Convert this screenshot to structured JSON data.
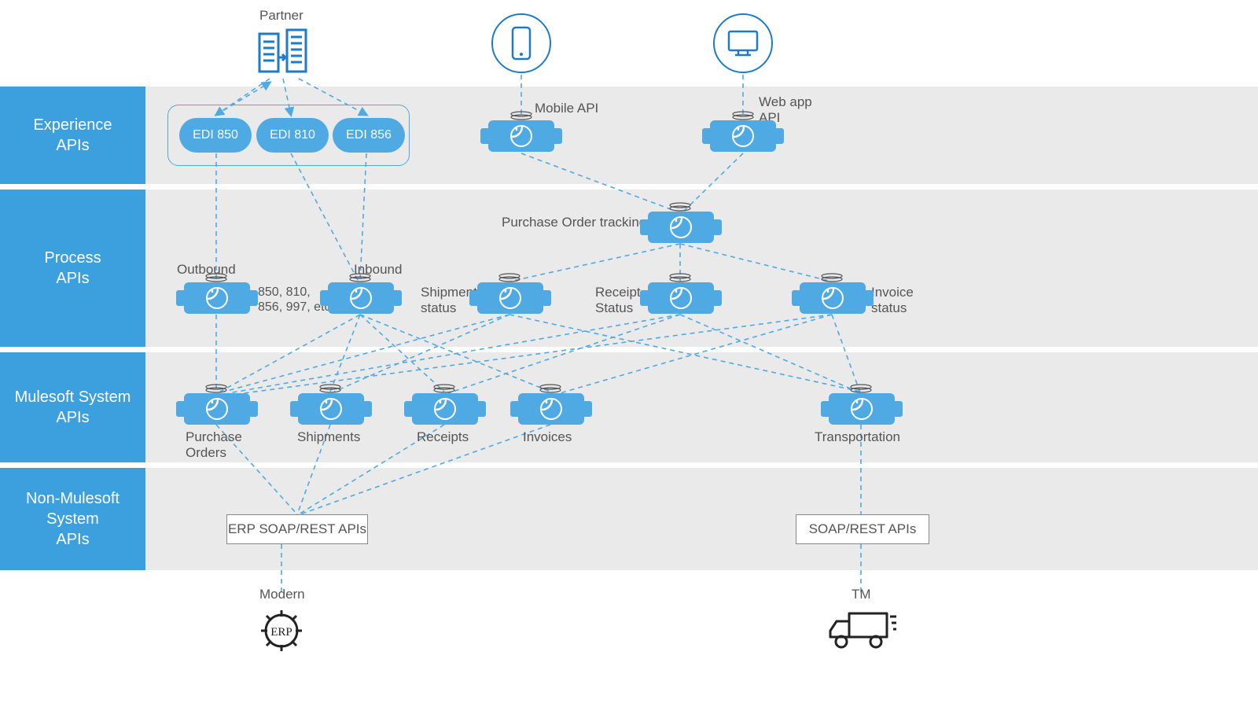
{
  "top": {
    "partner_label": "Partner",
    "mobile_label": "Mobile API",
    "web_label_line1": "Web app",
    "web_label_line2": "API"
  },
  "layers": {
    "experience": "Experience\nAPIs",
    "process": "Process\nAPIs",
    "system": "Mulesoft System\nAPIs",
    "nonmule": "Non-Mulesoft\nSystem\nAPIs"
  },
  "edi": {
    "edi850": "EDI 850",
    "edi810": "EDI 810",
    "edi856": "EDI 856"
  },
  "process": {
    "outbound": "Outbound",
    "outbound_sub": "850, 810,\n856, 997, etc",
    "inbound": "Inbound",
    "po_tracking": "Purchase Order tracking",
    "shipment_status": "Shipment\nstatus",
    "receipt_status": "Receipt\nStatus",
    "invoice_status": "Invoice\nstatus"
  },
  "system": {
    "purchase_orders": "Purchase\nOrders",
    "shipments": "Shipments",
    "receipts": "Receipts",
    "invoices": "Invoices",
    "transportation": "Transportation"
  },
  "nonmule": {
    "erp_apis": "ERP SOAP/REST APIs",
    "soap_rest": "SOAP/REST APIs",
    "modern": "Modern",
    "erp_gear": "ERP",
    "tm": "TM"
  },
  "colors": {
    "accent": "#3ba0dd",
    "node": "#4fa9e2",
    "band": "#eaeaea",
    "text": "#555"
  }
}
